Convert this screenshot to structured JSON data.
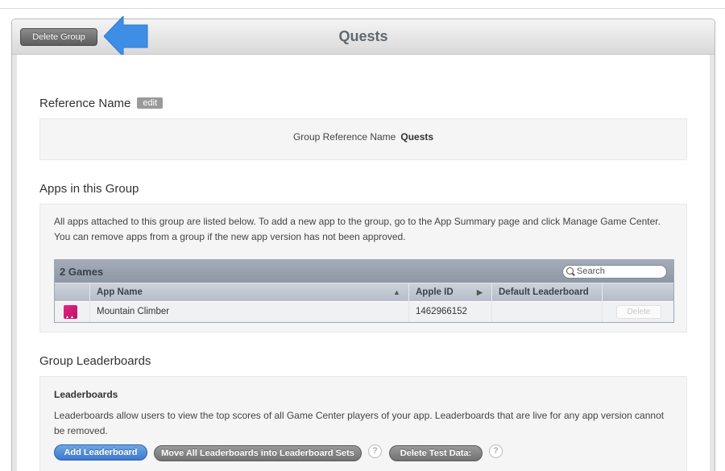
{
  "header": {
    "title": "Quests",
    "delete_group_label": "Delete Group"
  },
  "reference_name": {
    "section_title": "Reference Name",
    "edit_label": "edit",
    "group_reference_label": "Group Reference Name",
    "group_reference_value": "Quests"
  },
  "apps": {
    "section_title": "Apps in this Group",
    "description": "All apps attached to this group are listed below. To add a new app to the group, go to the App Summary page and click Manage Game Center. You can remove apps from a group if the new app version has not been approved.",
    "table": {
      "count_label": "2 Games",
      "search_placeholder": "Search",
      "columns": [
        "App Name",
        "Apple ID",
        "Default Leaderboard"
      ],
      "rows": [
        {
          "app_name": "Mountain Climber",
          "apple_id": "1462966152",
          "default_leaderboard": "",
          "delete_label": "Delete"
        }
      ]
    }
  },
  "leaderboards": {
    "section_title": "Group Leaderboards",
    "box_title": "Leaderboards",
    "description": "Leaderboards allow users to view the top scores of all Game Center players of your app. Leaderboards that are live for any app version cannot be removed.",
    "add_label": "Add Leaderboard",
    "move_label": "Move All Leaderboards into Leaderboard Sets",
    "delete_test_label": "Delete Test Data:",
    "help_symbol": "?"
  },
  "colors": {
    "accent_blue": "#3d78cf",
    "arrow_blue": "#3f8ee6",
    "app_icon_pink": "#e6257f"
  }
}
